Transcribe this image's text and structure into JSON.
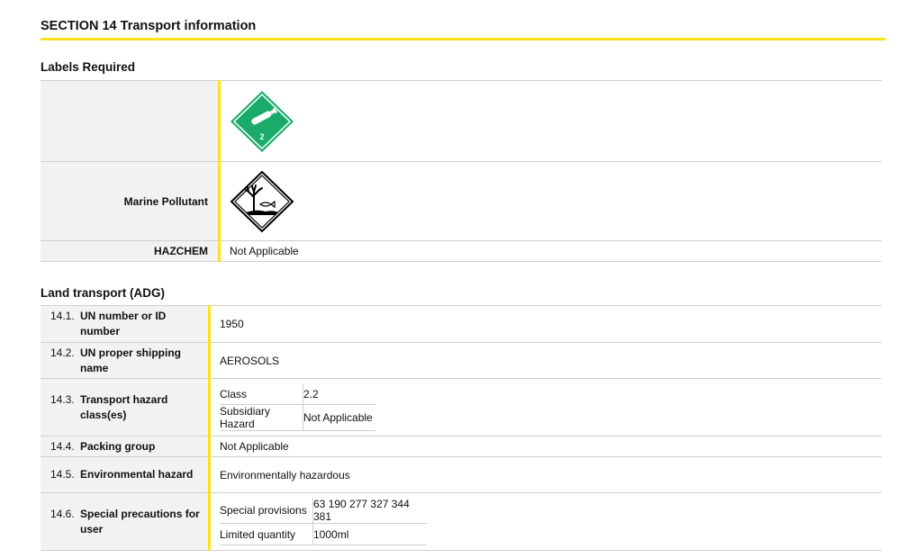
{
  "section": {
    "title": "SECTION 14 Transport information"
  },
  "labels_required": {
    "heading": "Labels Required",
    "rows": [
      {
        "label": "",
        "pictogram": "green-gas-cylinder-diamond-icon",
        "pictogram_number": "2"
      },
      {
        "label": "Marine Pollutant",
        "pictogram": "environment-hazard-diamond-icon"
      },
      {
        "label": "HAZCHEM",
        "value": "Not Applicable"
      }
    ]
  },
  "land_transport": {
    "heading": "Land transport (ADG)",
    "rows": [
      {
        "num": "14.1.",
        "label": "UN number or ID number",
        "value": "1950"
      },
      {
        "num": "14.2.",
        "label": "UN proper shipping name",
        "value": "AEROSOLS"
      },
      {
        "num": "14.3.",
        "label": "Transport hazard class(es)",
        "subtable": [
          [
            "Class",
            "2.2"
          ],
          [
            "Subsidiary Hazard",
            "Not Applicable"
          ]
        ]
      },
      {
        "num": "14.4.",
        "label": "Packing group",
        "value": "Not Applicable"
      },
      {
        "num": "14.5.",
        "label": "Environmental hazard",
        "value": "Environmentally hazardous"
      },
      {
        "num": "14.6.",
        "label": "Special precautions for user",
        "subtable": [
          [
            "Special provisions",
            "63 190 277 327 344 381"
          ],
          [
            "Limited quantity",
            "1000ml"
          ]
        ]
      }
    ]
  },
  "colors": {
    "accent_yellow": "#ffe21a",
    "label_bg": "#f2f2f2",
    "gas_green": "#1aab6a"
  }
}
